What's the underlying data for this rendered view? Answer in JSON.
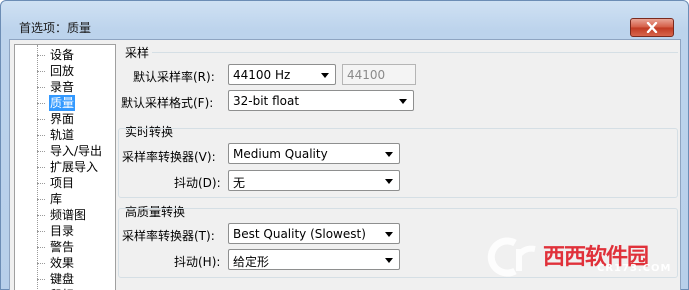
{
  "window": {
    "title": "首选项：质量"
  },
  "tree": {
    "items": [
      {
        "label": "设备"
      },
      {
        "label": "回放"
      },
      {
        "label": "录音"
      },
      {
        "label": "质量",
        "selected": true
      },
      {
        "label": "界面"
      },
      {
        "label": "轨道"
      },
      {
        "label": "导入/导出"
      },
      {
        "label": "扩展导入"
      },
      {
        "label": "项目"
      },
      {
        "label": "库"
      },
      {
        "label": "频谱图"
      },
      {
        "label": "目录"
      },
      {
        "label": "警告"
      },
      {
        "label": "效果"
      },
      {
        "label": "键盘"
      },
      {
        "label": "鼠标"
      }
    ]
  },
  "sampling": {
    "heading": "采样",
    "rate_label": "默认采样率(R):",
    "rate_value": "44100 Hz",
    "rate_custom": "44100",
    "format_label": "默认采样格式(F):",
    "format_value": "32-bit float"
  },
  "realtime": {
    "heading": "实时转换",
    "converter_label": "采样率转换器(V):",
    "converter_value": "Medium Quality",
    "dither_label": "抖动(D):",
    "dither_value": "无"
  },
  "hq": {
    "heading": "高质量转换",
    "converter_label": "采样率转换器(T):",
    "converter_value": "Best Quality (Slowest)",
    "dither_label": "抖动(H):",
    "dither_value": "给定形"
  },
  "watermark": {
    "brand": "西西软件园",
    "url": "CR173.COM"
  }
}
